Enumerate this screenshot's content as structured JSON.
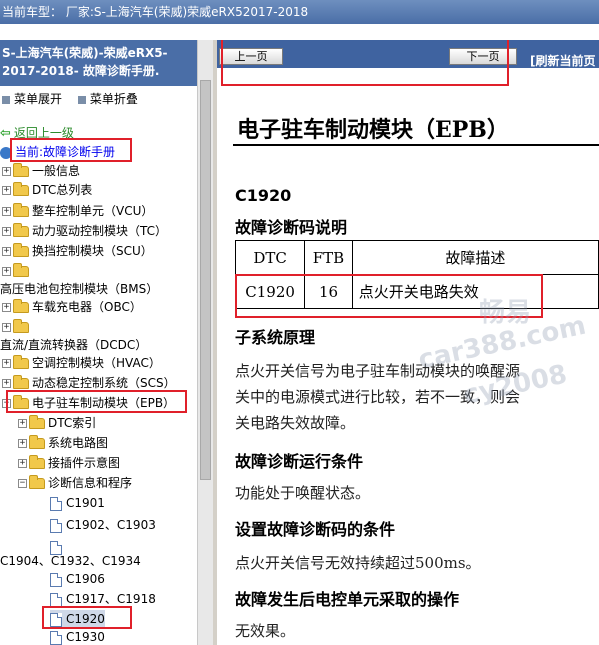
{
  "window": {
    "title": "当前车型： 厂家:S-上海汽车(荣威)荣威eRX52017-2018"
  },
  "sidebar": {
    "header": "S-上海汽车(荣威)-荣威eRX5-2017-2018- 故障诊断手册.",
    "expand_label": "菜单展开",
    "collapse_label": "菜单折叠",
    "back_label": "返回上一级",
    "current_prefix": "当前:",
    "current_value": "故障诊断手册",
    "tree": [
      "一般信息",
      "DTC总列表",
      "整车控制单元（VCU）",
      "动力驱动控制模块（TC）",
      "换挡控制模块（SCU）",
      "高压电池包控制模块（BMS）",
      "车载充电器（OBC）",
      "直流/直流转换器（DCDC）",
      "空调控制模块（HVAC）",
      "动态稳定控制系统（SCS）",
      "电子驻车制动模块（EPB）",
      "DTC索引",
      "系统电路图",
      "接插件示意图",
      "诊断信息和程序",
      "C1901",
      "C1902、C1903",
      "C1904、C1932、C1934",
      "C1906",
      "C1917、C1918",
      "C1920",
      "C1930"
    ]
  },
  "toolbar": {
    "prev_label": "上一页",
    "next_label": "下一页",
    "refresh_label": "[刷新当前页"
  },
  "document": {
    "title": "电子驻车制动模块（EPB）",
    "code": "C1920",
    "dtc_desc_heading": "故障诊断码说明",
    "table": {
      "headers": [
        "DTC",
        "FTB",
        "故障描述"
      ],
      "row": [
        "C1920",
        "16",
        "点火开关电路失效"
      ]
    },
    "principle_heading": "子系统原理",
    "principle_lines": [
      "点火开关信号为电子驻车制动模块的唤醒源",
      "关中的电源模式进行比较，若不一致，则会",
      "关电路失效故障。"
    ],
    "run_cond_heading": "故障诊断运行条件",
    "run_cond_text": "功能处于唤醒状态。",
    "set_cond_heading": "设置故障诊断码的条件",
    "set_cond_text": "点火开关信号无效持续超过500ms。",
    "action_heading": "故障发生后电控单元采取的操作",
    "action_text": "无效果。"
  },
  "watermarks": [
    "畅易",
    "car388.com",
    "cy2008"
  ]
}
